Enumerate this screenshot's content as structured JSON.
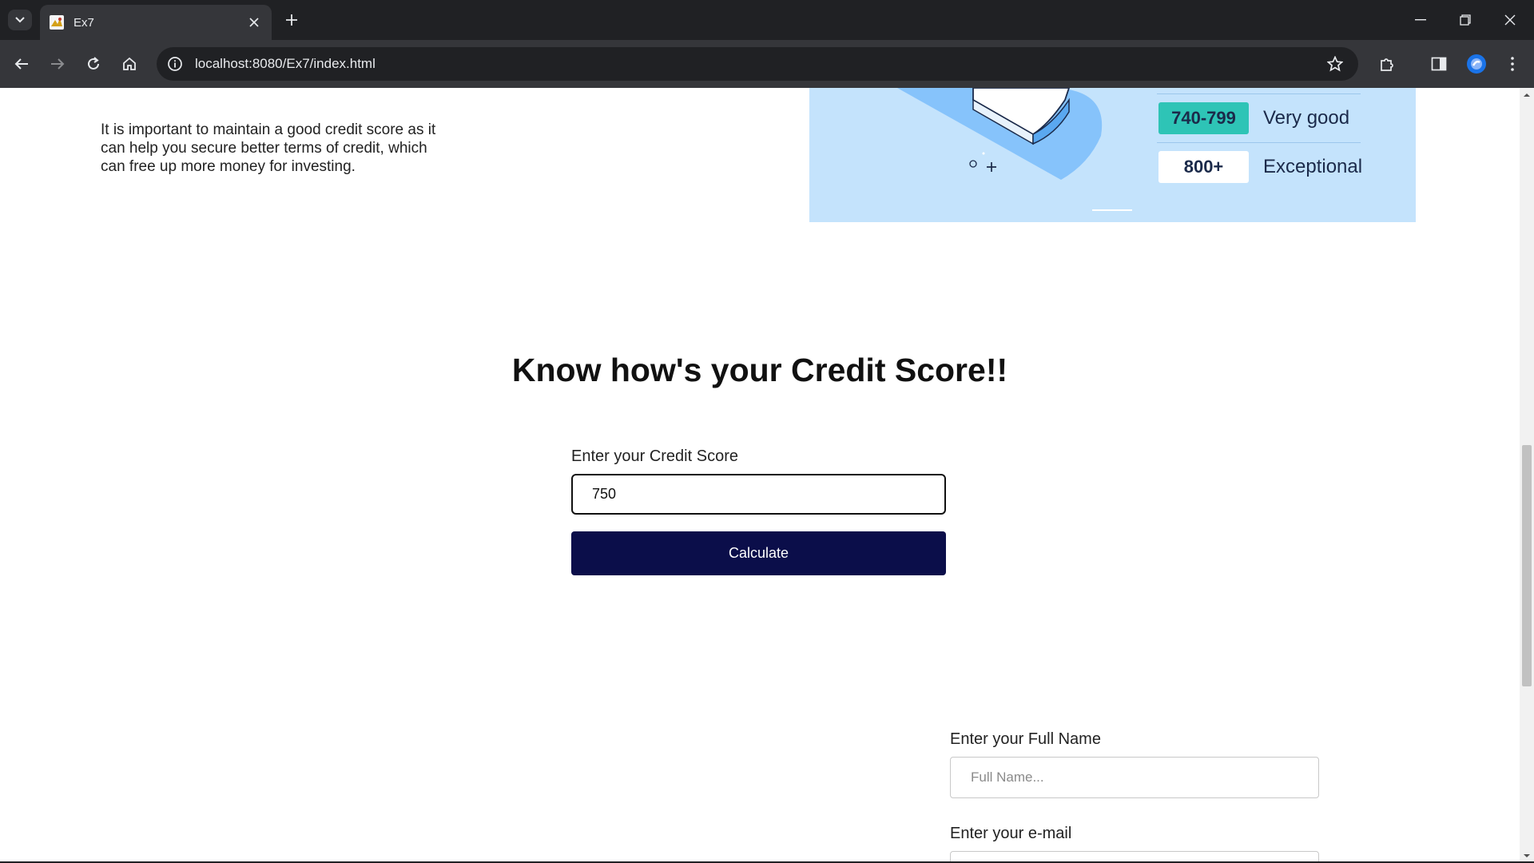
{
  "browser": {
    "tab_title": "Ex7",
    "url": "localhost:8080/Ex7/index.html"
  },
  "page": {
    "intro_text": "It is important to maintain a good credit score as it can help you secure better terms of credit, which can free up more money for investing.",
    "score_ranges": [
      {
        "range": "740-799",
        "label": "Very good",
        "color": "#2ec4b6"
      },
      {
        "range": "800+",
        "label": "Exceptional",
        "color": "#ffffff"
      }
    ],
    "heading": "Know how's your Credit Score!!",
    "credit_score": {
      "label": "Enter your Credit Score",
      "value": "750",
      "button_label": "Calculate"
    },
    "contact_form": {
      "name_label": "Enter your Full Name",
      "name_placeholder": "Full Name...",
      "email_label": "Enter your e-mail"
    }
  },
  "colors": {
    "accent": "#0b0e4a",
    "illustration_bg": "#c4e3fc"
  }
}
